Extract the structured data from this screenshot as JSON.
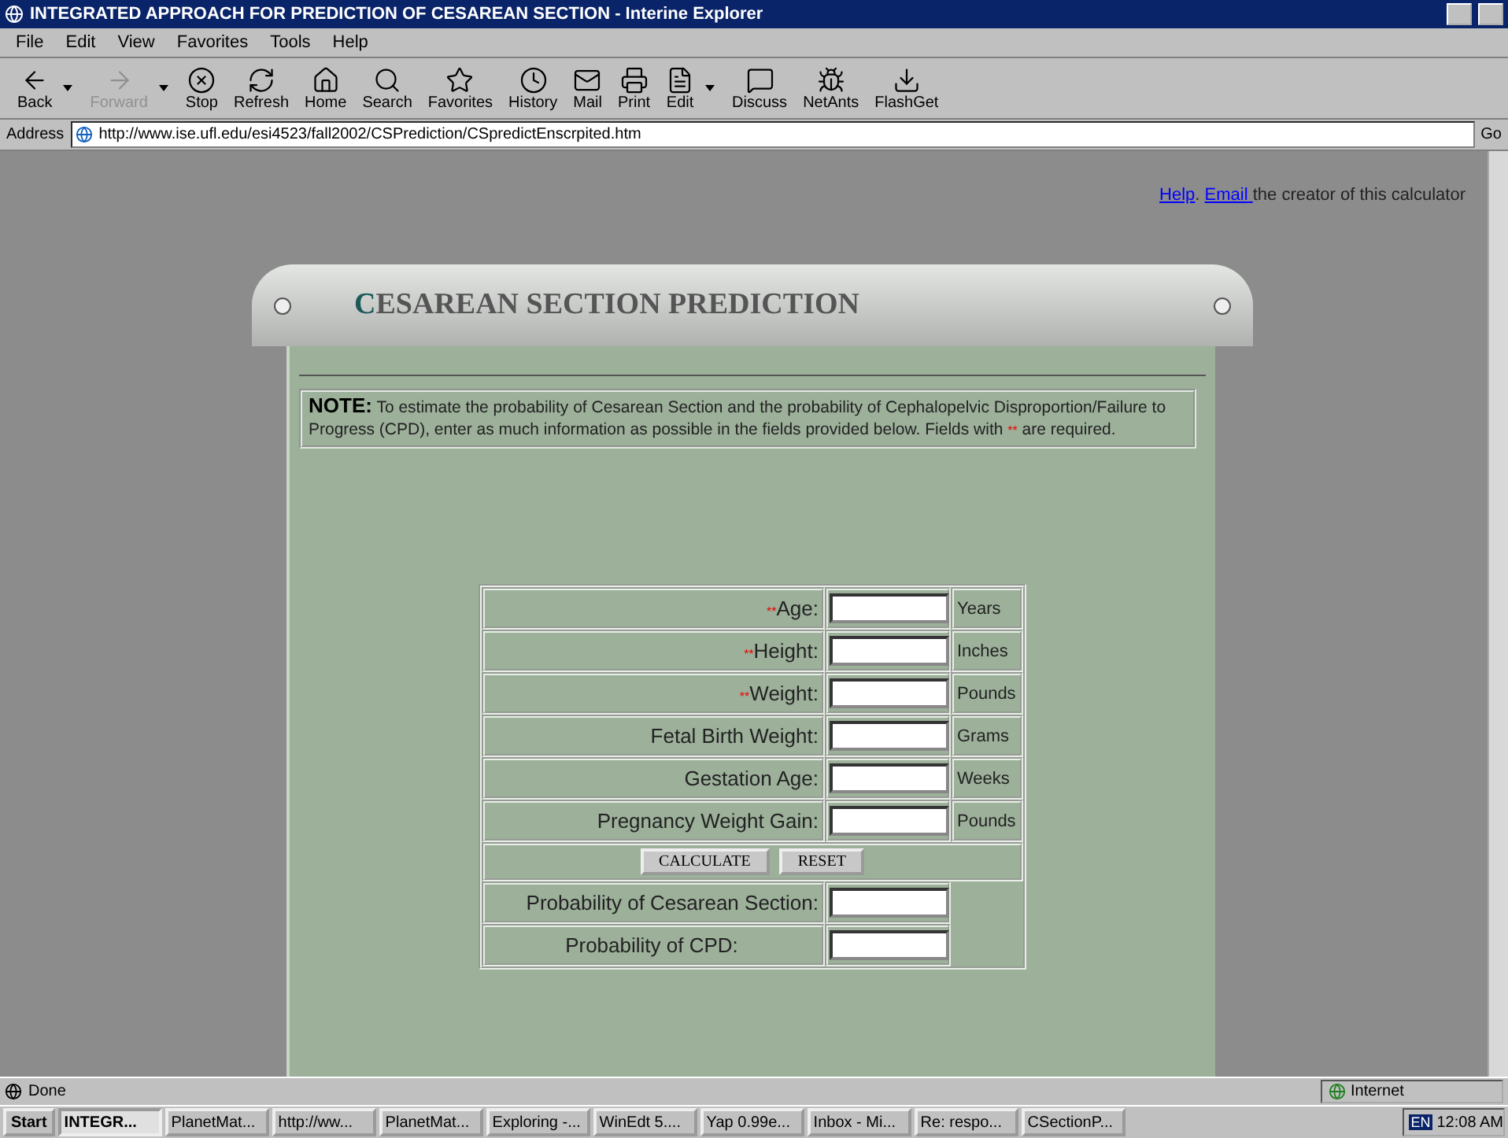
{
  "window": {
    "title": "INTEGRATED APPROACH FOR PREDICTION OF CESAREAN SECTION - Interine Explorer"
  },
  "menu": [
    "File",
    "Edit",
    "View",
    "Favorites",
    "Tools",
    "Help"
  ],
  "toolbar": [
    {
      "label": "Back",
      "kind": "back",
      "disabled": false,
      "dropdown": true
    },
    {
      "label": "Forward",
      "kind": "forward",
      "disabled": true,
      "dropdown": true
    },
    {
      "label": "Stop",
      "kind": "stop",
      "disabled": false,
      "dropdown": false
    },
    {
      "label": "Refresh",
      "kind": "refresh",
      "disabled": false,
      "dropdown": false
    },
    {
      "label": "Home",
      "kind": "home",
      "disabled": false,
      "dropdown": false
    },
    {
      "label": "Search",
      "kind": "search",
      "disabled": false,
      "dropdown": false
    },
    {
      "label": "Favorites",
      "kind": "favorites",
      "disabled": false,
      "dropdown": false
    },
    {
      "label": "History",
      "kind": "history",
      "disabled": false,
      "dropdown": false
    },
    {
      "label": "Mail",
      "kind": "mail",
      "disabled": false,
      "dropdown": false
    },
    {
      "label": "Print",
      "kind": "print",
      "disabled": false,
      "dropdown": false
    },
    {
      "label": "Edit",
      "kind": "edit",
      "disabled": false,
      "dropdown": true
    },
    {
      "label": "Discuss",
      "kind": "discuss",
      "disabled": false,
      "dropdown": false
    },
    {
      "label": "NetAnts",
      "kind": "ants",
      "disabled": false,
      "dropdown": false
    },
    {
      "label": "FlashGet",
      "kind": "flash",
      "disabled": false,
      "dropdown": false
    }
  ],
  "address": {
    "label": "Address",
    "value": "http://www.ise.ufl.edu/esi4523/fall2002/CSPrediction/CSpredictEnscrpited.htm",
    "go": "Go"
  },
  "page": {
    "links": {
      "help": "Help",
      "sep": ".",
      "email": "Email",
      "rest": "the creator of this calculator"
    },
    "heading": {
      "initial": "C",
      "rest": "ESAREAN SECTION PREDICTION"
    },
    "note": {
      "label": "NOTE:",
      "before": "To estimate the probability of Cesarean Section and the probability of Cephalopelvic Disproportion/Failure to Progress (CPD), enter as much information as possible in the fields provided below. Fields with",
      "marker": "**",
      "after": "are required."
    },
    "fields": [
      {
        "marker": "**",
        "label": "Age:",
        "unit": "Years"
      },
      {
        "marker": "**",
        "label": "Height:",
        "unit": "Inches"
      },
      {
        "marker": "**",
        "label": "Weight:",
        "unit": "Pounds"
      },
      {
        "label": "Fetal Birth Weight:",
        "unit": "Grams"
      },
      {
        "label": "Gestation Age:",
        "unit": "Weeks"
      },
      {
        "label": "Pregnancy Weight Gain:",
        "unit": "Pounds"
      }
    ],
    "buttons": [
      "CALCULATE",
      "RESET"
    ],
    "results": [
      {
        "label": "Probability of Cesarean Section:"
      },
      {
        "label": "Probability of CPD:"
      }
    ]
  },
  "status_bar": {
    "text": "Done",
    "zone": "Internet"
  },
  "taskbar": {
    "start": "Start",
    "items": [
      {
        "label": "INTEGR...",
        "selected": true
      },
      {
        "label": "PlanetMat...",
        "selected": false
      },
      {
        "label": "http://ww...",
        "selected": false
      },
      {
        "label": "PlanetMat...",
        "selected": false
      },
      {
        "label": "Exploring -...",
        "selected": false
      },
      {
        "label": "WinEdt 5....",
        "selected": false
      },
      {
        "label": "Yap 0.99e...",
        "selected": false
      },
      {
        "label": "Inbox - Mi...",
        "selected": false
      },
      {
        "label": "Re: respo...",
        "selected": false
      },
      {
        "label": "CSectionP...",
        "selected": false
      }
    ],
    "lang": "EN",
    "clock": "12:08 AM"
  }
}
